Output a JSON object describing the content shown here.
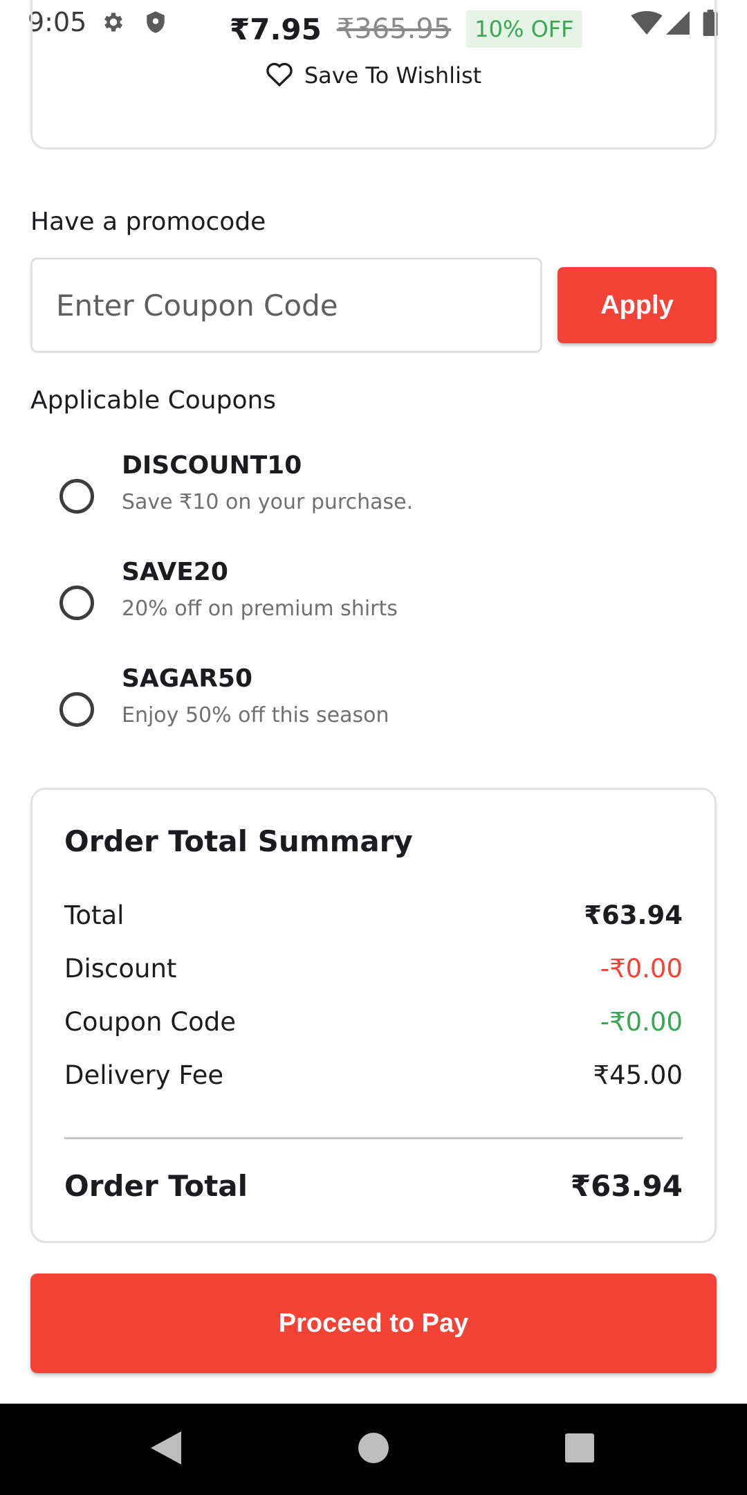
{
  "status_bar": {
    "time": "9:05",
    "icons": [
      "gear-icon",
      "shield-icon",
      "wifi-icon",
      "signal-icon",
      "battery-icon"
    ]
  },
  "product": {
    "price": "₹7.95",
    "original_price": "₹365.95",
    "discount_badge": "10% OFF",
    "wishlist_label": "Save To Wishlist"
  },
  "promo": {
    "heading": "Have a promocode",
    "input_value": "",
    "input_placeholder": "Enter Coupon Code",
    "apply_label": "Apply"
  },
  "coupons": {
    "heading": "Applicable Coupons",
    "items": [
      {
        "code": "DISCOUNT10",
        "description": "Save ₹10 on your purchase.",
        "selected": false
      },
      {
        "code": "SAVE20",
        "description": "20% off on premium shirts",
        "selected": false
      },
      {
        "code": "SAGAR50",
        "description": "Enjoy 50% off this season",
        "selected": false
      }
    ]
  },
  "summary": {
    "title": "Order Total Summary",
    "rows": [
      {
        "label": "Total",
        "value": "₹63.94"
      },
      {
        "label": "Discount",
        "value": "-₹0.00"
      },
      {
        "label": "Coupon Code",
        "value": "-₹0.00"
      },
      {
        "label": "Delivery Fee",
        "value": "₹45.00"
      }
    ],
    "order_total_label": "Order Total",
    "order_total_value": "₹63.94"
  },
  "actions": {
    "pay_label": "Proceed to Pay"
  },
  "colors": {
    "accent": "#f44336",
    "success": "#3aa655",
    "text": "#1c1b1f",
    "muted": "#707070",
    "border": "#e2e2e2"
  }
}
